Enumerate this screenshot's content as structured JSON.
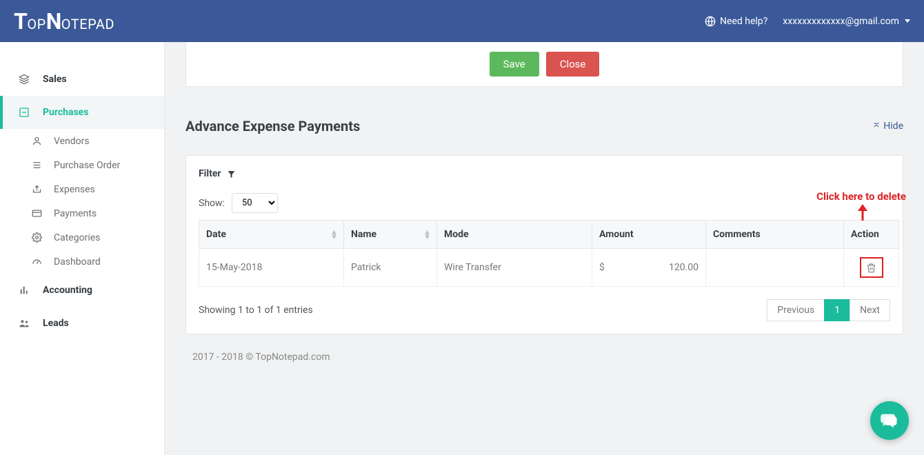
{
  "brand": "TopNotepad",
  "header": {
    "help_label": "Need help?",
    "user_email": "xxxxxxxxxxxxx@gmail.com"
  },
  "sidebar": {
    "items": [
      {
        "label": "Sales",
        "active": false
      },
      {
        "label": "Purchases",
        "active": true
      },
      {
        "label": "Accounting",
        "active": false
      },
      {
        "label": "Leads",
        "active": false
      }
    ],
    "purchases_sub": [
      {
        "label": "Vendors"
      },
      {
        "label": "Purchase Order"
      },
      {
        "label": "Expenses"
      },
      {
        "label": "Payments"
      },
      {
        "label": "Categories"
      },
      {
        "label": "Dashboard"
      }
    ]
  },
  "buttons": {
    "save": "Save",
    "close": "Close"
  },
  "section": {
    "title": "Advance Expense Payments",
    "hide_label": "Hide"
  },
  "filter": {
    "label": "Filter",
    "show_label": "Show:",
    "show_value": "50",
    "entries_text": "Showing 1 to 1 of 1 entries"
  },
  "table": {
    "columns": {
      "date": "Date",
      "name": "Name",
      "mode": "Mode",
      "amount": "Amount",
      "comments": "Comments",
      "action": "Action"
    },
    "rows": [
      {
        "date": "15-May-2018",
        "name": "Patrick",
        "mode": "Wire Transfer",
        "currency": "$",
        "amount": "120.00",
        "comments": ""
      }
    ]
  },
  "pager": {
    "prev": "Previous",
    "page": "1",
    "next": "Next"
  },
  "annotation": {
    "text": "Click here to delete"
  },
  "footer": {
    "copyright": "2017 - 2018 © TopNotepad.com"
  }
}
